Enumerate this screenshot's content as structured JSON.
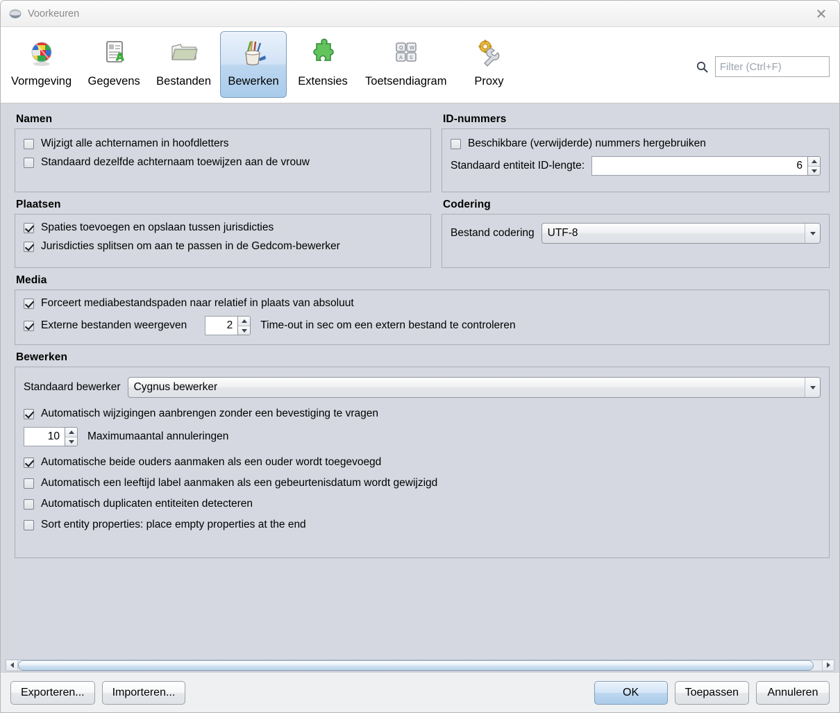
{
  "window": {
    "title": "Voorkeuren",
    "app_icon": "globe-icon",
    "close_label": "✕"
  },
  "toolbar": {
    "tabs": [
      {
        "label": "Vormgeving",
        "icon": "flags-globe-icon",
        "selected": false
      },
      {
        "label": "Gegevens",
        "icon": "document-a-icon",
        "selected": false
      },
      {
        "label": "Bestanden",
        "icon": "folder-icon",
        "selected": false
      },
      {
        "label": "Bewerken",
        "icon": "pencil-cup-icon",
        "selected": true
      },
      {
        "label": "Extensies",
        "icon": "puzzle-piece-icon",
        "selected": false
      },
      {
        "label": "Toetsendiagram",
        "icon": "keyboard-keys-icon",
        "selected": false
      },
      {
        "label": "Proxy",
        "icon": "gear-wrench-icon",
        "selected": false
      }
    ],
    "filter": {
      "icon": "search-icon",
      "placeholder": "Filter (Ctrl+F)",
      "value": ""
    }
  },
  "groups": {
    "namen": {
      "title": "Namen",
      "checkboxes": [
        {
          "label": "Wijzigt alle achternamen in hoofdletters",
          "checked": false
        },
        {
          "label": "Standaard dezelfde achternaam toewijzen aan de vrouw",
          "checked": false
        }
      ]
    },
    "id_nummers": {
      "title": "ID-nummers",
      "checkbox": {
        "label": "Beschikbare (verwijderde) nummers hergebruiken",
        "checked": false
      },
      "spinner_label": "Standaard entiteit ID-lengte:",
      "spinner_value": "6"
    },
    "plaatsen": {
      "title": "Plaatsen",
      "checkboxes": [
        {
          "label": "Spaties toevoegen en opslaan tussen jurisdicties",
          "checked": true
        },
        {
          "label": "Jurisdicties splitsen om aan te passen in de Gedcom-bewerker",
          "checked": true
        }
      ]
    },
    "codering": {
      "title": "Codering",
      "label": "Bestand codering",
      "value": "UTF-8"
    },
    "media": {
      "title": "Media",
      "checkbox_1": {
        "label": "Forceert mediabestandspaden naar relatief in plaats van absoluut",
        "checked": true
      },
      "checkbox_2": {
        "label": "Externe bestanden weergeven",
        "checked": true
      },
      "timeout_value": "2",
      "timeout_label": "Time-out in sec om een extern bestand te controleren"
    },
    "bewerken": {
      "title": "Bewerken",
      "editor_label": "Standaard bewerker",
      "editor_value": "Cygnus bewerker",
      "checkbox_auto_changes": {
        "label": "Automatisch wijzigingen aanbrengen zonder een bevestiging te vragen",
        "checked": true
      },
      "undo_value": "10",
      "undo_label": "Maximumaantal annuleringen",
      "checkbox_both_parents": {
        "label": "Automatische beide ouders aanmaken als een ouder wordt toegevoegd",
        "checked": true
      },
      "checkbox_age_label": {
        "label": "Automatisch een leeftijd label aanmaken als een gebeurtenisdatum wordt gewijzigd",
        "checked": false
      },
      "checkbox_duplicates": {
        "label": "Automatisch duplicaten entiteiten detecteren",
        "checked": false
      },
      "checkbox_sort": {
        "label": "Sort entity properties: place empty properties at the end",
        "checked": false
      }
    }
  },
  "footer": {
    "export_label": "Exporteren...",
    "import_label": "Importeren...",
    "ok_label": "OK",
    "apply_label": "Toepassen",
    "cancel_label": "Annuleren"
  },
  "colors": {
    "content_bg": "#d5d8e0",
    "selected_tab": "#bcd6ef",
    "default_button": "#bcd7ef"
  }
}
